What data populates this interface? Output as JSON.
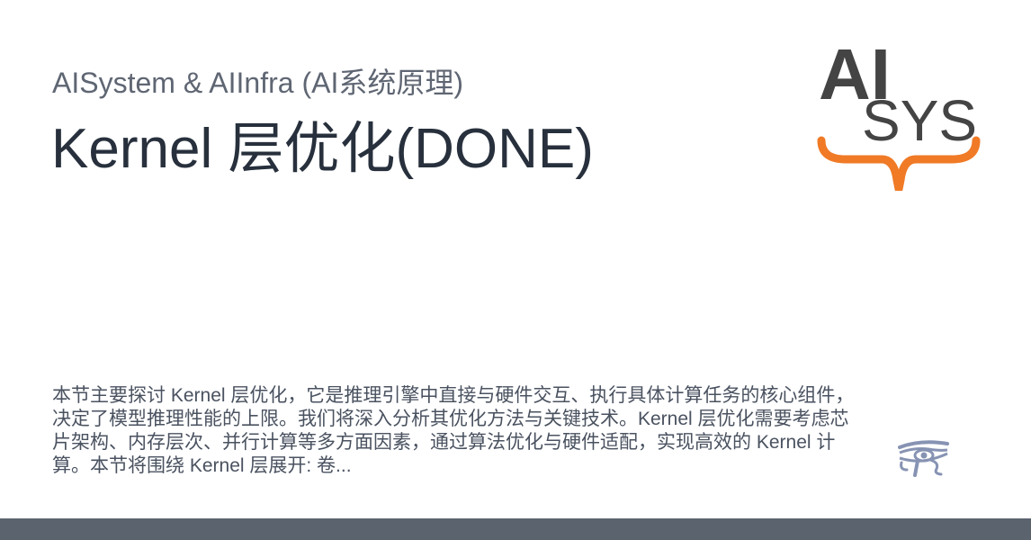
{
  "header": {
    "subtitle": "AISystem & AIInfra (AI系统原理)",
    "title": "Kernel 层优化(DONE)"
  },
  "logo": {
    "name": "AISYS logo",
    "line1": "AI",
    "line2": "SYS",
    "colors": {
      "text": "#444444",
      "brace": "#f07a26"
    }
  },
  "description": {
    "text": "本节主要探讨 Kernel 层优化，它是推理引擎中直接与硬件交互、执行具体计算任务的核心组件，决定了模型推理性能的上限。我们将深入分析其优化方法与关键技术。Kernel 层优化需要考虑芯片架构、内存层次、并行计算等多方面因素，通过算法优化与硬件适配，实现高效的 Kernel 计算。本节将围绕 Kernel 层展开: 卷..."
  },
  "theme": {
    "icon": "eye-of-horus-icon",
    "color": "#8793b3"
  },
  "footer": {
    "color": "#5b636f"
  }
}
